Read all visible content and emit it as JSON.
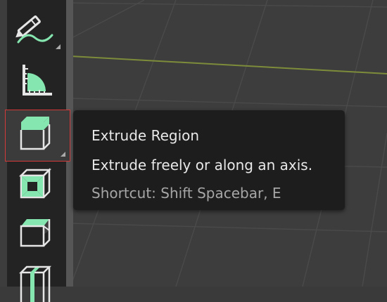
{
  "tooltip": {
    "title": "Extrude Region",
    "description": "Extrude freely or along an axis.",
    "shortcut": "Shortcut: Shift Spacebar, E"
  },
  "toolbar": {
    "tools": [
      {
        "icon": "annotate-icon",
        "has_submenu": true
      },
      {
        "icon": "measure-icon",
        "has_submenu": false
      },
      {
        "icon": "extrude-region-icon",
        "has_submenu": true,
        "active": true
      },
      {
        "icon": "inset-faces-icon",
        "has_submenu": false
      },
      {
        "icon": "bevel-icon",
        "has_submenu": false
      },
      {
        "icon": "loop-cut-icon",
        "has_submenu": false
      }
    ]
  },
  "colors": {
    "accent": "#86e6b0",
    "highlight_border": "#d23a3a",
    "viewport_bg": "#3d3d3d",
    "x_axis": "#7d8c3a"
  }
}
